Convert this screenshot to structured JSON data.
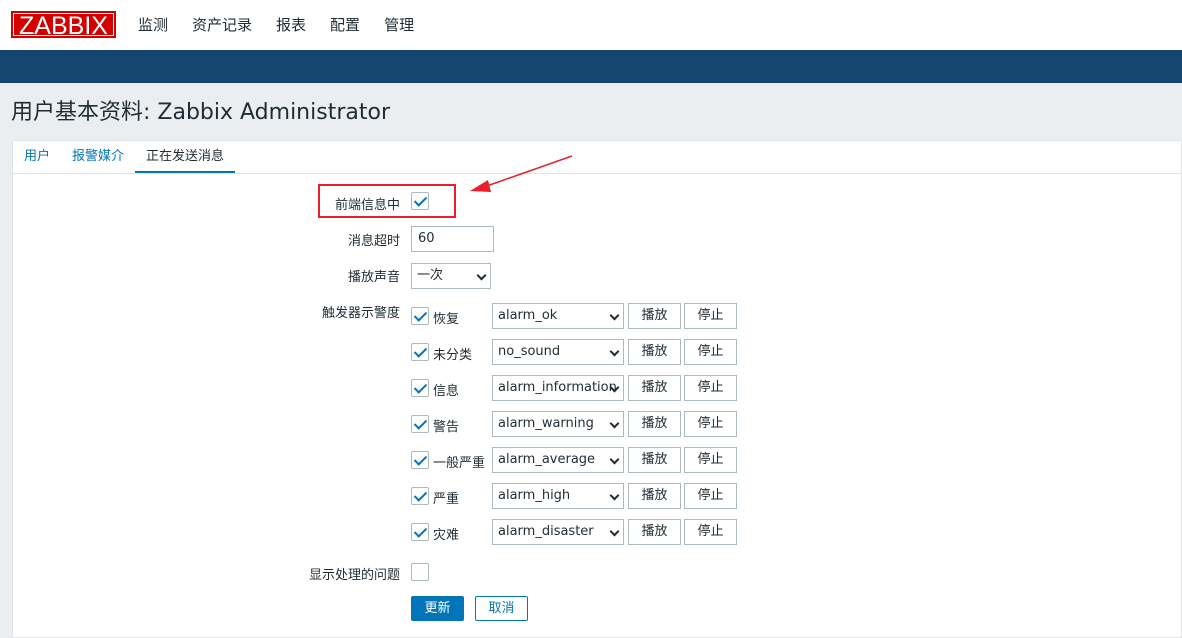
{
  "header": {
    "logo": "ZABBIX",
    "menu": [
      "监测",
      "资产记录",
      "报表",
      "配置",
      "管理"
    ]
  },
  "page": {
    "title": "用户基本资料: Zabbix Administrator"
  },
  "tabs": [
    {
      "label": "用户",
      "active": false
    },
    {
      "label": "报警媒介",
      "active": false
    },
    {
      "label": "正在发送消息",
      "active": true
    }
  ],
  "form": {
    "frontend_messaging": {
      "label": "前端信息中",
      "checked": true
    },
    "message_timeout": {
      "label": "消息超时",
      "value": "60"
    },
    "play_sound": {
      "label": "播放声音",
      "value": "一次"
    },
    "trigger_severity": {
      "label": "触发器示警度"
    },
    "severities": [
      {
        "label": "恢复",
        "checked": true,
        "sound": "alarm_ok"
      },
      {
        "label": "未分类",
        "checked": true,
        "sound": "no_sound"
      },
      {
        "label": "信息",
        "checked": true,
        "sound": "alarm_information"
      },
      {
        "label": "警告",
        "checked": true,
        "sound": "alarm_warning"
      },
      {
        "label": "一般严重",
        "checked": true,
        "sound": "alarm_average"
      },
      {
        "label": "严重",
        "checked": true,
        "sound": "alarm_high"
      },
      {
        "label": "灾难",
        "checked": true,
        "sound": "alarm_disaster"
      }
    ],
    "play_button": "播放",
    "stop_button": "停止",
    "show_suppressed": {
      "label": "显示处理的问题",
      "checked": false
    },
    "update_button": "更新",
    "cancel_button": "取消"
  },
  "colors": {
    "brand": "#d40000",
    "header_bar": "#154672",
    "accent": "#0275b8",
    "annotation": "#e8202b"
  }
}
